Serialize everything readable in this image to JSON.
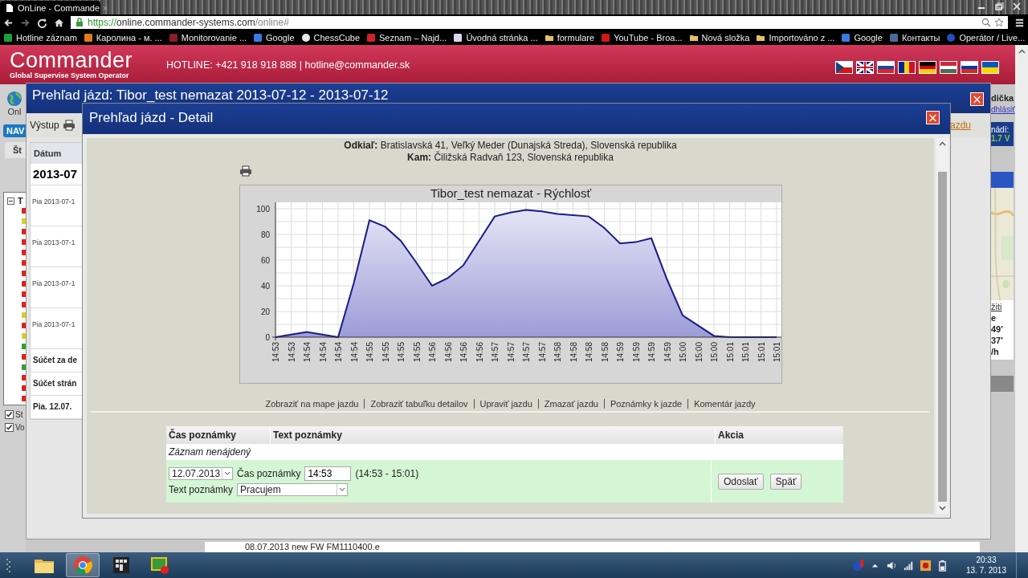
{
  "browser": {
    "tab": {
      "title": "OnLine - Commande",
      "close": "×"
    },
    "address": {
      "scheme": "https://",
      "host": "online.commander-systems.com",
      "path": "/online#"
    },
    "bookmarks": [
      {
        "label": "Hotline záznam",
        "kind": "square",
        "color": "#1f9d3a"
      },
      {
        "label": "Каролина - м. ...",
        "kind": "square",
        "color": "#e07b20"
      },
      {
        "label": "Monitorovanie ...",
        "kind": "square",
        "color": "#8a1c2c"
      },
      {
        "label": "Google",
        "kind": "square",
        "color": "#3b7ae0"
      },
      {
        "label": "ChessCube",
        "kind": "circle",
        "color": "#e8e8e8"
      },
      {
        "label": "Seznam – Najd...",
        "kind": "square",
        "color": "#d0202a"
      },
      {
        "label": "Úvodná stránka ...",
        "kind": "square",
        "color": "#d8d8f0"
      },
      {
        "label": "formulare",
        "kind": "folder",
        "color": "#e8c060"
      },
      {
        "label": "YouTube - Broa...",
        "kind": "square",
        "color": "#d01818"
      },
      {
        "label": "Nová složka",
        "kind": "folder",
        "color": "#e8c060"
      },
      {
        "label": "Importováno z ...",
        "kind": "folder",
        "color": "#e8c060"
      },
      {
        "label": "Google",
        "kind": "square",
        "color": "#3b7ae0"
      },
      {
        "label": "Контакты",
        "kind": "square",
        "color": "#4a6a9a"
      },
      {
        "label": "Operátor / Live...",
        "kind": "circle",
        "color": "#2050c0"
      }
    ]
  },
  "header": {
    "logo": "Commander",
    "tagline": "Global Supervise System Operator",
    "hotline": "HOTLINE: +421 918 918 888 | hotline@commander.sk"
  },
  "left_panel": {
    "app_label": "Onl",
    "nav_tab": "NAV",
    "tab": "Št",
    "tree_root": "T",
    "status_dots": [
      {
        "color": "#e02020"
      },
      {
        "color": "#d8d020"
      },
      {
        "color": "#e02020"
      },
      {
        "color": "#e02020"
      },
      {
        "color": "#e02020"
      },
      {
        "color": "#e02020"
      },
      {
        "color": "#e02020"
      },
      {
        "color": "#e02020"
      },
      {
        "color": "#e02020"
      },
      {
        "color": "#e02020"
      },
      {
        "color": "#d8d020"
      },
      {
        "color": "#e02020"
      },
      {
        "color": "#d8d020"
      },
      {
        "color": "#30a030"
      },
      {
        "color": "#e02020"
      },
      {
        "color": "#30a030"
      },
      {
        "color": "#e02020"
      },
      {
        "color": "#e02020"
      },
      {
        "color": "#e02020"
      }
    ],
    "checkboxes": [
      {
        "label": "St",
        "checked": true
      },
      {
        "label": "Vo",
        "checked": true
      }
    ]
  },
  "right_panel": {
    "user": "dička",
    "logout_link": "dhlásiť",
    "battery_label": "nádí:",
    "battery_value": "1.7 V",
    "map_link": "žiti",
    "lines": [
      "e",
      "49'",
      "37'",
      "/h"
    ]
  },
  "trip_window": {
    "title": "Prehľad jázd: Tibor_test nemazat  2013-07-12 - 2013-07-12",
    "close": "×",
    "export_label": "Výstup",
    "link": "azdu",
    "table": {
      "header": "Dátum",
      "date": "2013-07",
      "rows": [
        "Pia 2013-07-1",
        "Pia 2013-07-1",
        "Pia 2013-07-1",
        "Pia 2013-07-1"
      ],
      "sums": [
        "Súčet za de",
        "Súčet strán",
        "Pia. 12.07."
      ]
    }
  },
  "detail_dialog": {
    "title": "Prehľad jázd - Detail",
    "close": "×",
    "from_label": "Odkiaľ:",
    "from": "Bratislavská 41, Veľký Meder (Dunajská Streda), Slovenská republika",
    "to_label": "Kam:",
    "to": "Čiližská Radvaň 123, Slovenská republika",
    "chart": {
      "chart_data": {
        "type": "area",
        "title": "Tibor_test nemazat - Rýchlosť",
        "categories": [
          "14:53",
          "14:53",
          "14:54",
          "14:54",
          "14:54",
          "14:54",
          "14:55",
          "14:55",
          "14:55",
          "14:55",
          "14:56",
          "14:56",
          "14:56",
          "14:56",
          "14:57",
          "14:57",
          "14:57",
          "14:57",
          "14:58",
          "14:58",
          "14:58",
          "14:58",
          "14:59",
          "14:59",
          "14:59",
          "14:59",
          "15:00",
          "15:00",
          "15:00",
          "15:01",
          "15:01",
          "15:01",
          "15:01"
        ],
        "grid": true,
        "series": [
          {
            "color": "#1a1a8a",
            "values": [
              0,
              2,
              4,
              2,
              0,
              42,
              91,
              86,
              75,
              58,
              40,
              46,
              56,
              75,
              94,
              97,
              99,
              98,
              96,
              95,
              94,
              85,
              73,
              74,
              77,
              45,
              17,
              9,
              1,
              0,
              0,
              0,
              0
            ]
          }
        ],
        "ylim": [
          0,
          100
        ],
        "yticks": [
          0,
          20,
          40,
          60,
          80,
          100
        ]
      }
    },
    "links": [
      "Zobraziť na mape jazdu",
      "Zobraziť tabuľku detailov",
      "Upraviť jazdu",
      "Zmazať jazdu",
      "Poznámky k jazde",
      "Komentár jazdy"
    ],
    "notes": {
      "columns": [
        "Čas poznámky",
        "Text poznámky",
        "Akcia"
      ],
      "empty_text": "Záznam nenájdený",
      "date": "12.07.2013",
      "time_label": "Čas poznámky",
      "time": "14:53",
      "range": "(14:53 - 15:01)",
      "text_label": "Text poznámky",
      "text_value": "Pracujem",
      "buttons": [
        "Odoslať",
        "Späť"
      ]
    }
  },
  "status_text": "08.07.2013 new FW FM1110400.e",
  "taskbar": {
    "apps": [
      {
        "kind": "folder",
        "selected": false
      },
      {
        "kind": "browser",
        "selected": true
      },
      {
        "kind": "grid",
        "selected": false
      },
      {
        "kind": "monitor",
        "selected": false
      }
    ],
    "time": "20:33",
    "date": "13. 7. 2013"
  }
}
